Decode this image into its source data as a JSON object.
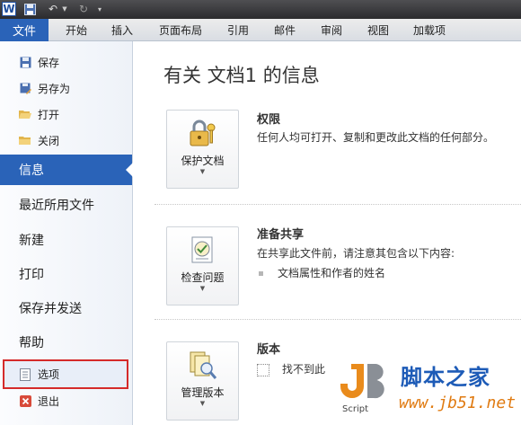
{
  "quick_access": {
    "logo": "W"
  },
  "ribbon_tabs": [
    {
      "label": "文件",
      "left": 0
    },
    {
      "label": "开始"
    },
    {
      "label": "插入"
    },
    {
      "label": "页面布局"
    },
    {
      "label": "引用"
    },
    {
      "label": "邮件"
    },
    {
      "label": "审阅"
    },
    {
      "label": "视图"
    },
    {
      "label": "加载项"
    }
  ],
  "sidebar": {
    "small_items": [
      {
        "label": "保存",
        "icon": "save-icon"
      },
      {
        "label": "另存为",
        "icon": "save-as-icon"
      },
      {
        "label": "打开",
        "icon": "open-folder-icon"
      },
      {
        "label": "关闭",
        "icon": "close-folder-icon"
      }
    ],
    "big_items": [
      {
        "label": "信息"
      },
      {
        "label": "最近所用文件"
      },
      {
        "label": "新建"
      },
      {
        "label": "打印"
      },
      {
        "label": "保存并发送"
      },
      {
        "label": "帮助"
      }
    ],
    "bottom_items": [
      {
        "label": "选项",
        "icon": "options-icon"
      },
      {
        "label": "退出",
        "icon": "exit-icon"
      }
    ]
  },
  "main": {
    "title": "有关 文档1 的信息",
    "sections": [
      {
        "button_label": "保护文档",
        "title": "权限",
        "description": "任何人均可打开、复制和更改此文档的任何部分。",
        "icon": "lock-key-icon"
      },
      {
        "button_label": "检查问题",
        "title": "准备共享",
        "description": "在共享此文件前，请注意其包含以下内容:",
        "bullets": [
          "文档属性和作者的姓名"
        ],
        "icon": "checklist-icon"
      },
      {
        "button_label": "管理版本",
        "title": "版本",
        "description": "找不到此",
        "icon": "versions-icon"
      }
    ]
  },
  "watermark": {
    "name": "脚本之家",
    "url": "www.jb51.net",
    "logo_text": "Script"
  }
}
